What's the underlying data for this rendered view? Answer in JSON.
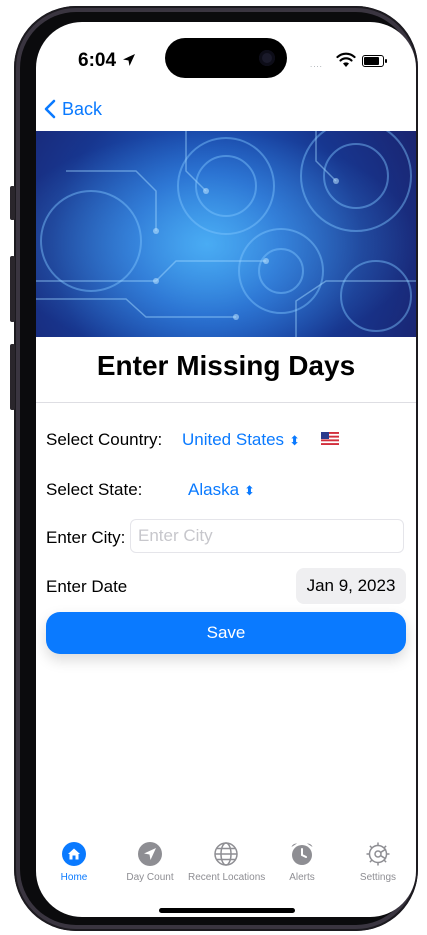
{
  "status_bar": {
    "time": "6:04"
  },
  "nav": {
    "back_label": "Back"
  },
  "page": {
    "title": "Enter Missing Days"
  },
  "form": {
    "country_label": "Select Country:",
    "country_value": "United States",
    "country_flag": "us-flag-icon",
    "state_label": "Select State:",
    "state_value": "Alaska",
    "city_label": "Enter City:",
    "city_value": "",
    "city_placeholder": "Enter City",
    "date_label": "Enter Date",
    "date_value": "Jan 9, 2023",
    "save_label": "Save"
  },
  "tabs": [
    {
      "label": "Home",
      "icon": "home-icon",
      "active": true
    },
    {
      "label": "Day Count",
      "icon": "location-arrow-icon",
      "active": false
    },
    {
      "label": "Recent Locations",
      "icon": "globe-icon",
      "active": false
    },
    {
      "label": "Alerts",
      "icon": "alarm-clock-icon",
      "active": false
    },
    {
      "label": "Settings",
      "icon": "gear-icon",
      "active": false
    }
  ],
  "colors": {
    "accent": "#0a7aff",
    "inactive_tab": "#8e8e93",
    "hero_dark": "#1a2470",
    "hero_light": "#2f8fe6"
  }
}
